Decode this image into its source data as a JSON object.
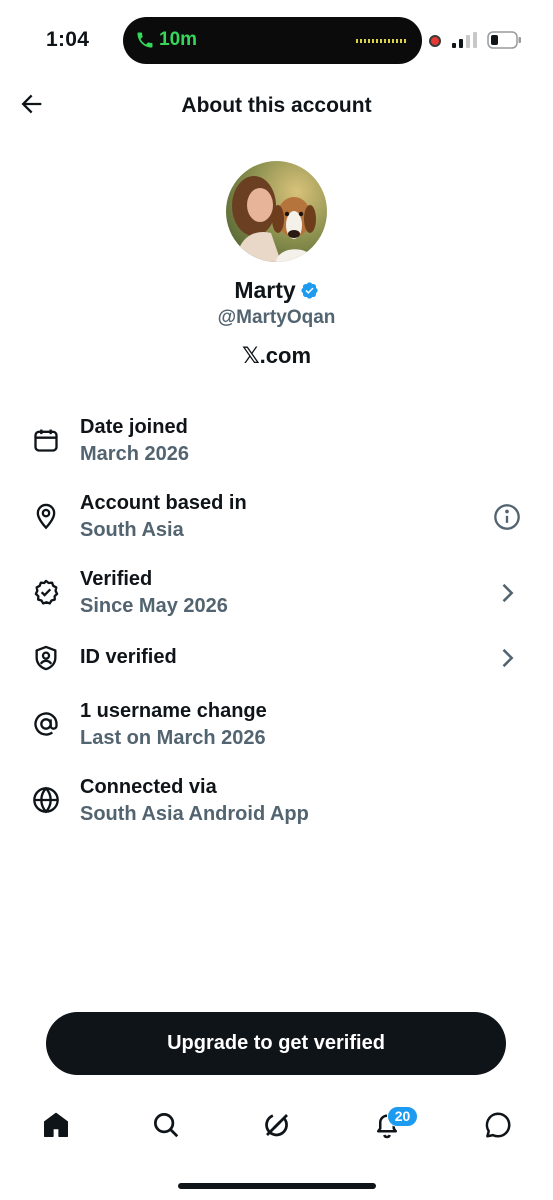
{
  "status_bar": {
    "time": "1:04",
    "call_duration": "10m"
  },
  "header": {
    "title": "About this account"
  },
  "profile": {
    "name": "Marty",
    "handle": "@MartyOqan",
    "site": "𝕏.com"
  },
  "info_items": [
    {
      "title": "Date joined",
      "subtitle": "March 2026",
      "icon": "calendar-icon"
    },
    {
      "title": "Account based in",
      "subtitle": "South Asia",
      "icon": "location-pin-icon",
      "action": "info-icon"
    },
    {
      "title": "Verified",
      "subtitle": "Since May 2026",
      "icon": "verified-badge-icon",
      "action": "chevron-right-icon"
    },
    {
      "title": "ID verified",
      "subtitle": "",
      "icon": "shield-person-icon",
      "action": "chevron-right-icon"
    },
    {
      "title": "1 username change",
      "subtitle": "Last on March 2026",
      "icon": "at-sign-icon"
    },
    {
      "title": "Connected via",
      "subtitle": "South Asia Android App",
      "icon": "globe-icon"
    }
  ],
  "upgrade_button": {
    "label": "Upgrade to get verified"
  },
  "tab_bar": {
    "notifications_count": "20",
    "tabs": [
      "home-icon",
      "search-icon",
      "grok-icon",
      "notifications-icon",
      "messages-icon"
    ]
  },
  "colors": {
    "text": "#0f1419",
    "secondary_text": "#536471",
    "accent": "#1d9bf0",
    "call_green": "#36d65a"
  }
}
